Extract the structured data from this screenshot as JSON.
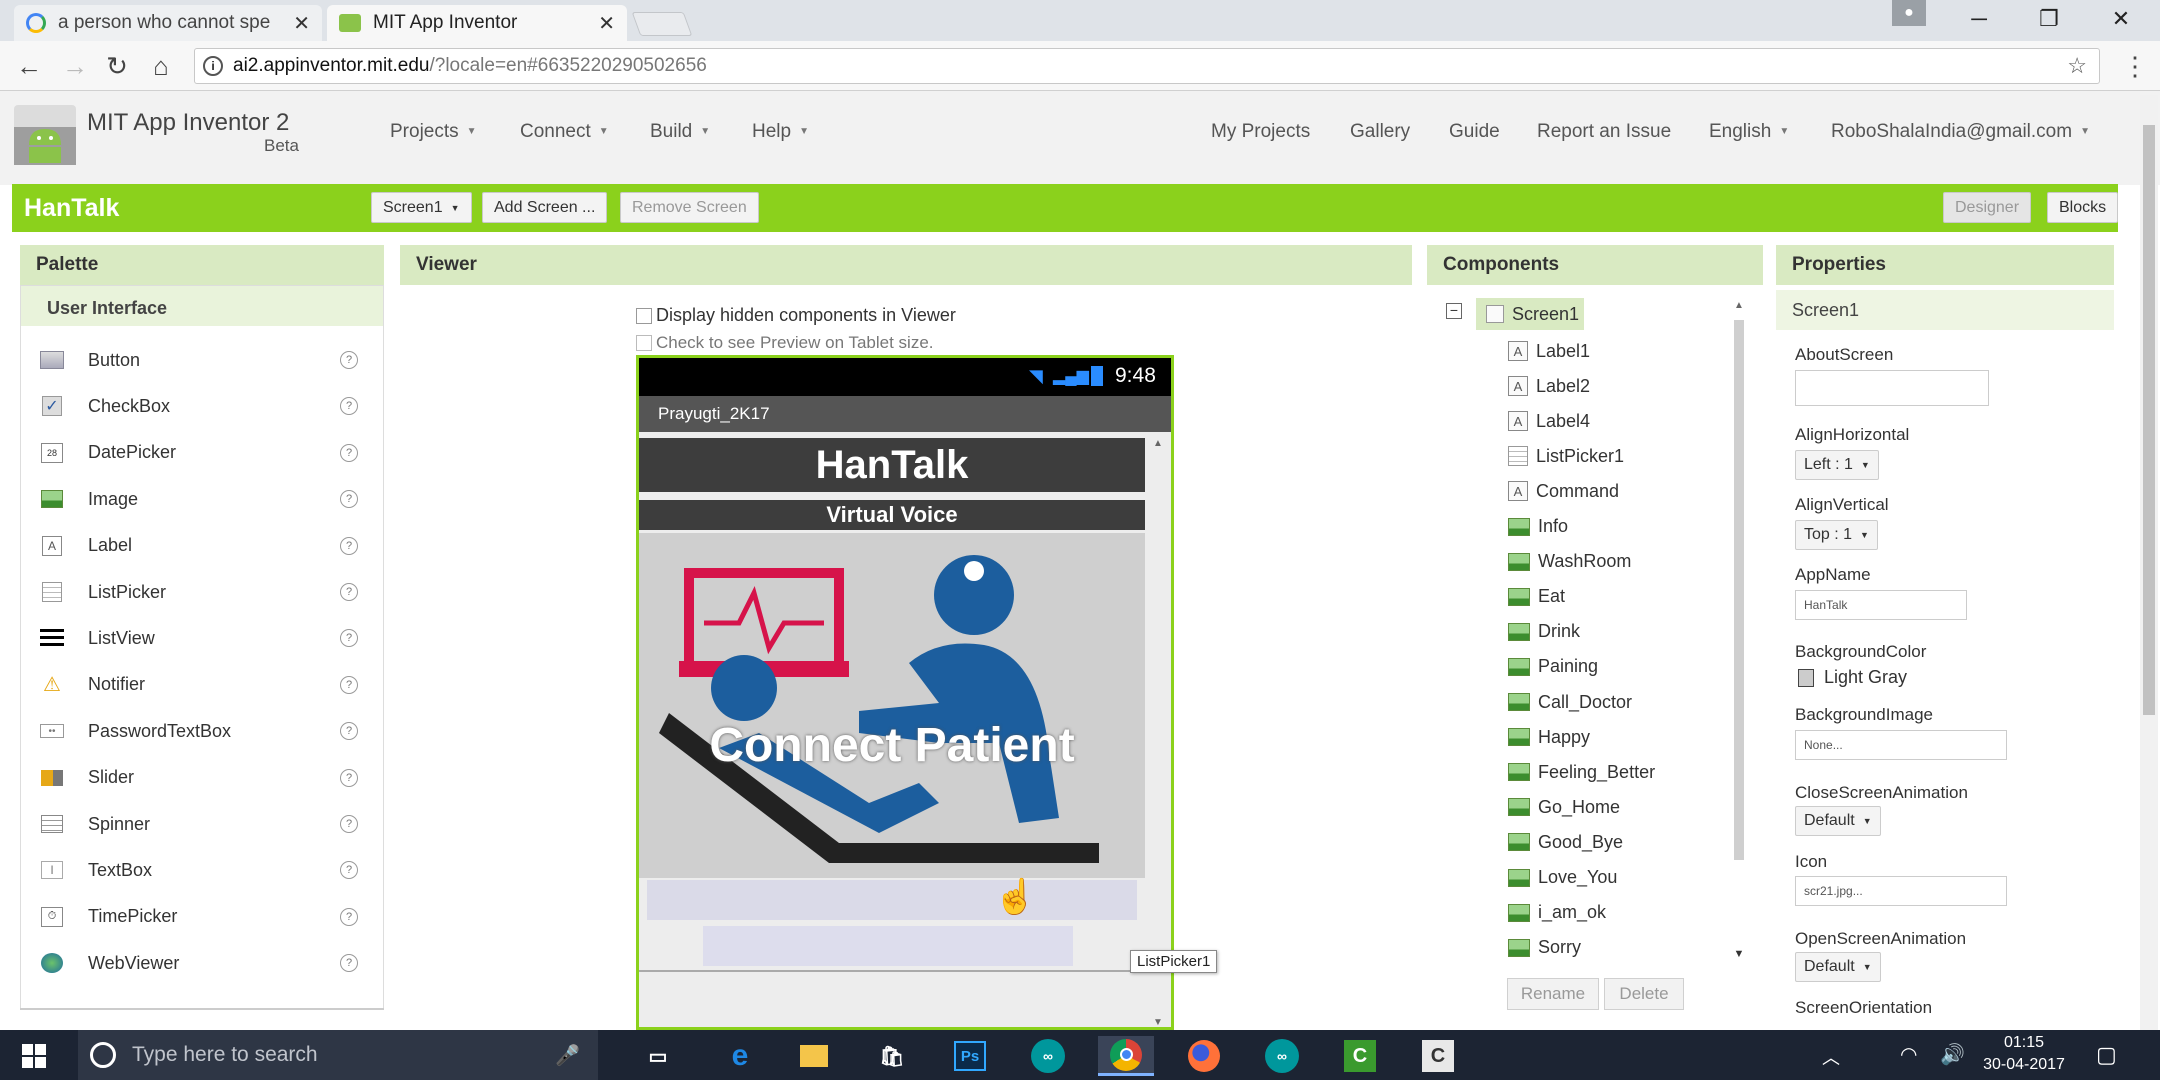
{
  "browser": {
    "tabs": [
      {
        "title": "a person who cannot spe",
        "active": false
      },
      {
        "title": "MIT App Inventor",
        "active": true
      }
    ],
    "url_domain": "ai2.appinventor.mit.edu",
    "url_path": "/?locale=en#6635220290502656"
  },
  "app": {
    "name": "MIT App Inventor 2",
    "beta": "Beta",
    "menus": [
      "Projects",
      "Connect",
      "Build",
      "Help"
    ],
    "links": [
      "My Projects",
      "Gallery",
      "Guide",
      "Report an Issue",
      "English"
    ],
    "user": "RoboShalaIndia@gmail.com"
  },
  "project": {
    "name": "HanTalk",
    "screen_btn": "Screen1",
    "add_screen": "Add Screen ...",
    "remove_screen": "Remove Screen",
    "designer": "Designer",
    "blocks": "Blocks"
  },
  "palette": {
    "title": "Palette",
    "section": "User Interface",
    "items": [
      "Button",
      "CheckBox",
      "DatePicker",
      "Image",
      "Label",
      "ListPicker",
      "ListView",
      "Notifier",
      "PasswordTextBox",
      "Slider",
      "Spinner",
      "TextBox",
      "TimePicker",
      "WebViewer"
    ]
  },
  "viewer": {
    "title": "Viewer",
    "hidden_chk": "Display hidden components in Viewer",
    "tablet_chk": "Check to see Preview on Tablet size.",
    "time": "9:48",
    "screen_title": "Prayugti_2K17",
    "label1": "HanTalk",
    "label2": "Virtual Voice",
    "image_caption": "Connect Patient",
    "tooltip": "ListPicker1"
  },
  "components": {
    "title": "Components",
    "root": "Screen1",
    "items": [
      {
        "name": "Label1",
        "kind": "label"
      },
      {
        "name": "Label2",
        "kind": "label"
      },
      {
        "name": "Label4",
        "kind": "label"
      },
      {
        "name": "ListPicker1",
        "kind": "listpicker"
      },
      {
        "name": "Command",
        "kind": "label"
      },
      {
        "name": "Info",
        "kind": "image"
      },
      {
        "name": "WashRoom",
        "kind": "image"
      },
      {
        "name": "Eat",
        "kind": "image"
      },
      {
        "name": "Drink",
        "kind": "image"
      },
      {
        "name": "Paining",
        "kind": "image"
      },
      {
        "name": "Call_Doctor",
        "kind": "image"
      },
      {
        "name": "Happy",
        "kind": "image"
      },
      {
        "name": "Feeling_Better",
        "kind": "image"
      },
      {
        "name": "Go_Home",
        "kind": "image"
      },
      {
        "name": "Good_Bye",
        "kind": "image"
      },
      {
        "name": "Love_You",
        "kind": "image"
      },
      {
        "name": "i_am_ok",
        "kind": "image"
      },
      {
        "name": "Sorry",
        "kind": "image"
      }
    ],
    "rename": "Rename",
    "delete": "Delete"
  },
  "properties": {
    "title": "Properties",
    "component": "Screen1",
    "about_label": "AboutScreen",
    "alignh_label": "AlignHorizontal",
    "alignh_value": "Left : 1",
    "alignv_label": "AlignVertical",
    "alignv_value": "Top : 1",
    "appname_label": "AppName",
    "appname_value": "HanTalk",
    "bgcolor_label": "BackgroundColor",
    "bgcolor_value": "Light Gray",
    "bgimage_label": "BackgroundImage",
    "bgimage_value": "None...",
    "close_anim_label": "CloseScreenAnimation",
    "close_anim_value": "Default",
    "icon_label": "Icon",
    "icon_value": "scr21.jpg...",
    "open_anim_label": "OpenScreenAnimation",
    "open_anim_value": "Default",
    "orientation_label": "ScreenOrientation"
  },
  "taskbar": {
    "search_placeholder": "Type here to search",
    "time": "01:15",
    "date": "30-04-2017"
  },
  "colors": {
    "green_bar": "#8bd11c",
    "panel_header": "#d9eac2",
    "phone_header": "#3d3d3d"
  }
}
